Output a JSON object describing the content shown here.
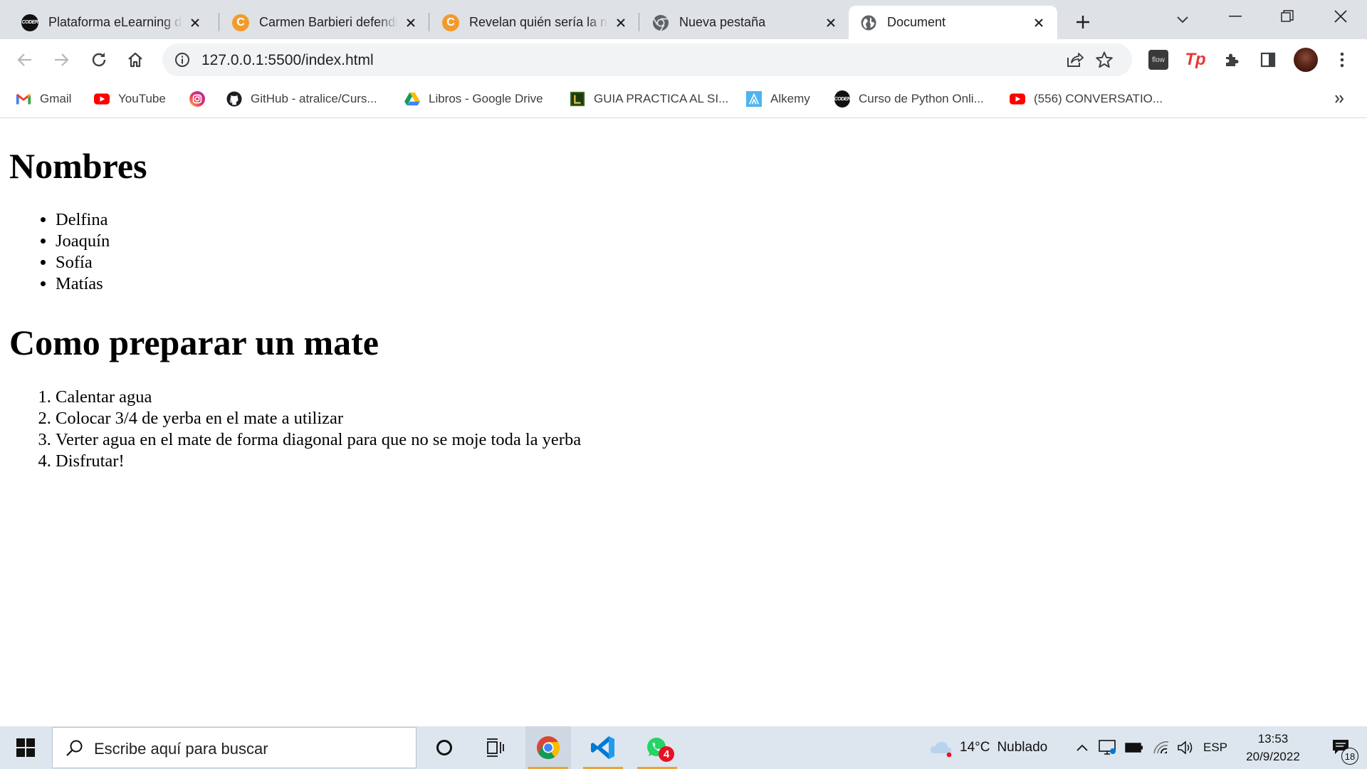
{
  "tabs": [
    {
      "title": "Plataforma eLearning de",
      "icon": "coder-logo-icon",
      "icon_text": "CODER",
      "active": false
    },
    {
      "title": "Carmen Barbieri defendió",
      "icon": "c-logo-icon",
      "icon_text": "C",
      "active": false
    },
    {
      "title": "Revelan quién sería la nu",
      "icon": "c-logo-icon",
      "icon_text": "C",
      "active": false
    },
    {
      "title": "Nueva pestaña",
      "icon": "chrome-icon",
      "active": false
    },
    {
      "title": "Document",
      "icon": "globe-icon",
      "active": true
    }
  ],
  "address_bar": {
    "url": "127.0.0.1:5500/index.html"
  },
  "extensions": {
    "flow_label": "flow",
    "tp_label": "Tp"
  },
  "bookmarks": [
    {
      "label": "Gmail",
      "icon": "gmail-icon"
    },
    {
      "label": "YouTube",
      "icon": "youtube-icon"
    },
    {
      "label": "",
      "icon": "instagram-icon"
    },
    {
      "label": "GitHub - atralice/Curs...",
      "icon": "github-icon"
    },
    {
      "label": "Libros - Google Drive",
      "icon": "google-drive-icon"
    },
    {
      "label": "GUIA PRACTICA AL SI...",
      "icon": "book-icon"
    },
    {
      "label": "Alkemy",
      "icon": "alkemy-icon"
    },
    {
      "label": "Curso de Python Onli...",
      "icon": "coder-logo-icon",
      "icon_text": "CODER"
    },
    {
      "label": "(556) CONVERSATIO...",
      "icon": "youtube-icon"
    }
  ],
  "page": {
    "heading1": "Nombres",
    "names": [
      "Delfina",
      "Joaquín",
      "Sofía",
      "Matías"
    ],
    "heading2": "Como preparar un mate",
    "steps": [
      "Calentar agua",
      "Colocar 3/4 de yerba en el mate a utilizar",
      "Verter agua en el mate de forma diagonal para que no se moje toda la yerba",
      "Disfrutar!"
    ]
  },
  "taskbar": {
    "search_placeholder": "Escribe aquí para buscar",
    "whatsapp_badge": "4",
    "weather": {
      "temp": "14°C",
      "condition": "Nublado"
    },
    "language": "ESP",
    "time": "13:53",
    "date": "20/9/2022",
    "notifications_count": "18"
  },
  "colors": {
    "tabstrip_bg": "#dee1e6",
    "taskbar_bg": "#dde6ee",
    "youtube_red": "#ff0000",
    "chrome_red": "#db4437",
    "vscode_blue": "#0078d4",
    "whatsapp_green": "#25d366"
  }
}
